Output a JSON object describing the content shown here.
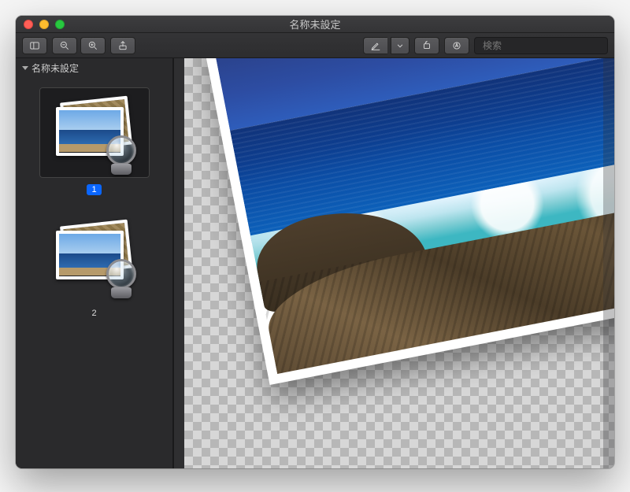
{
  "window": {
    "title": "名称未設定"
  },
  "toolbar": {
    "sidebar_toggle_icon": "sidebar-toggle",
    "zoom_out_icon": "zoom-out",
    "zoom_in_icon": "zoom-in",
    "share_icon": "share",
    "markup_icon": "markup-pen",
    "markup_dropdown_icon": "chevron-down",
    "rotate_icon": "rotate",
    "annotate_icon": "annotate-circle"
  },
  "search": {
    "placeholder": "検索",
    "value": ""
  },
  "sidebar": {
    "header_label": "名称未設定",
    "pages": [
      {
        "label": "1",
        "selected": true
      },
      {
        "label": "2",
        "selected": false
      }
    ]
  },
  "canvas": {
    "image_description": "rotated coastal seascape photograph on transparency checkerboard"
  }
}
